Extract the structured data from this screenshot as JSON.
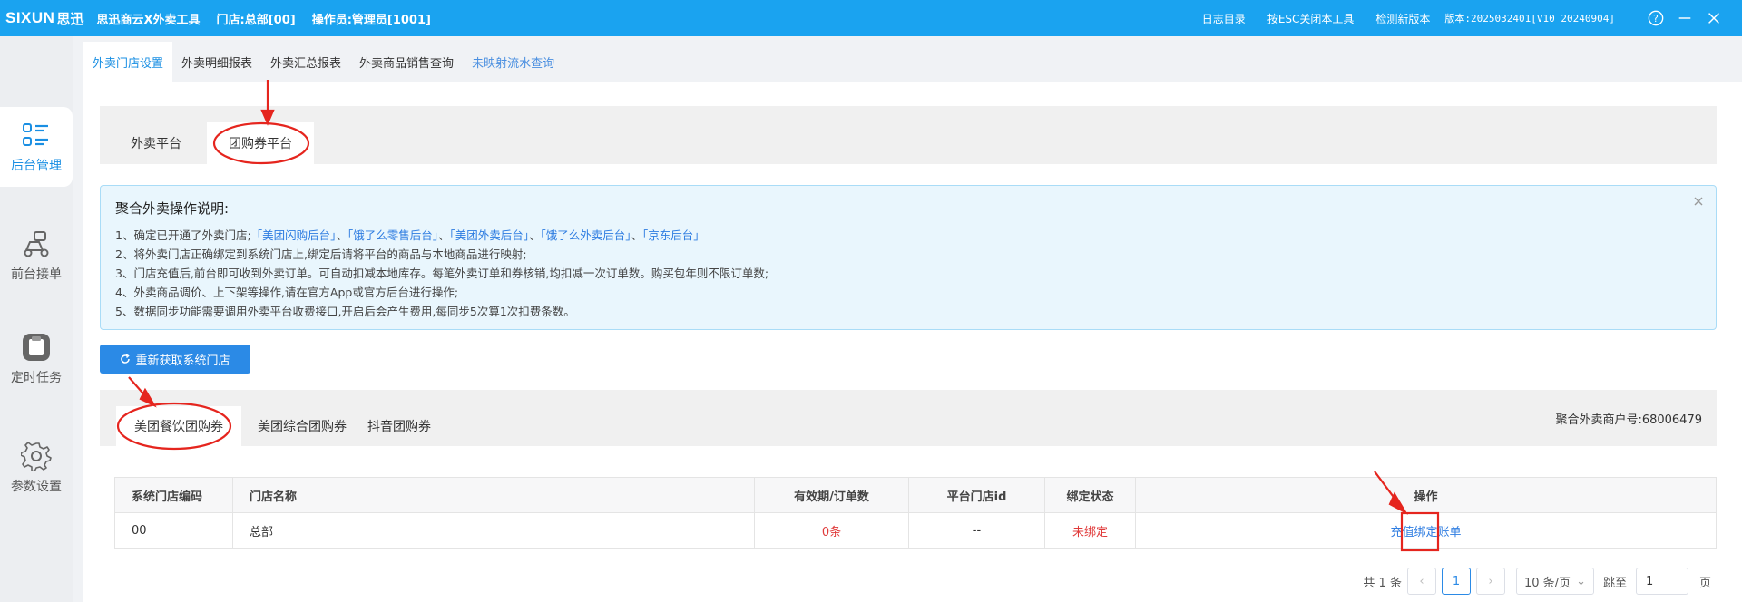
{
  "titlebar": {
    "brand_en": "SIXUN",
    "brand_cn": "思迅",
    "app_name": "思迅商云X外卖工具",
    "store": "门店:总部[00]",
    "operator": "操作员:管理员[1001]",
    "log_dir": "日志目录",
    "esc_hint": "按ESC关闭本工具",
    "check_update": "检测新版本",
    "version": "版本:2025032401[V10 20240904]"
  },
  "sidebar": {
    "items": [
      {
        "label": "后台管理",
        "icon": "list-icon"
      },
      {
        "label": "前台接单",
        "icon": "scooter-icon"
      },
      {
        "label": "定时任务",
        "icon": "task-icon"
      },
      {
        "label": "参数设置",
        "icon": "gear-icon"
      }
    ]
  },
  "topnav": {
    "tabs": [
      {
        "label": "外卖门店设置"
      },
      {
        "label": "外卖明细报表"
      },
      {
        "label": "外卖汇总报表"
      },
      {
        "label": "外卖商品销售查询"
      },
      {
        "label": "未映射流水查询"
      }
    ]
  },
  "platform_tabs": [
    {
      "label": "外卖平台"
    },
    {
      "label": "团购券平台"
    }
  ],
  "notice": {
    "title": "聚合外卖操作说明:",
    "line1_prefix": "1、确定已开通了外卖门店;",
    "links": [
      "「美团闪购后台」",
      "「饿了么零售后台」",
      "「美团外卖后台」",
      "「饿了么外卖后台」",
      "「京东后台」"
    ],
    "sep": "、",
    "line2": "2、将外卖门店正确绑定到系统门店上,绑定后请将平台的商品与本地商品进行映射;",
    "line3": "3、门店充值后,前台即可收到外卖订单。可自动扣减本地库存。每笔外卖订单和券核销,均扣减一次订单数。购买包年则不限订单数;",
    "line4": "4、外卖商品调价、上下架等操作,请在官方App或官方后台进行操作;",
    "line5": "5、数据同步功能需要调用外卖平台收费接口,开启后会产生费用,每同步5次算1次扣费条数。"
  },
  "refresh_button": "重新获取系统门店",
  "groupon_tabs": [
    {
      "label": "美团餐饮团购券"
    },
    {
      "label": "美团综合团购券"
    },
    {
      "label": "抖音团购券"
    }
  ],
  "merchant_no": "聚合外卖商户号:68006479",
  "table": {
    "headers": [
      "系统门店编码",
      "门店名称",
      "有效期/订单数",
      "平台门店id",
      "绑定状态",
      "操作"
    ],
    "rows": [
      {
        "code": "00",
        "name": "总部",
        "validity": "0条",
        "platform_id": "--",
        "status": "未绑定",
        "actions": [
          "充值",
          "绑定",
          "账单"
        ]
      }
    ]
  },
  "pager": {
    "total": "共 1 条",
    "current_page": "1",
    "page_size": "10 条/页",
    "jump_label": "跳至",
    "jump_value": "1",
    "page_suffix": "页"
  },
  "colors": {
    "titlebar": "#1aa3f0",
    "accent": "#2b8ae6",
    "annotation": "#e5251e"
  }
}
